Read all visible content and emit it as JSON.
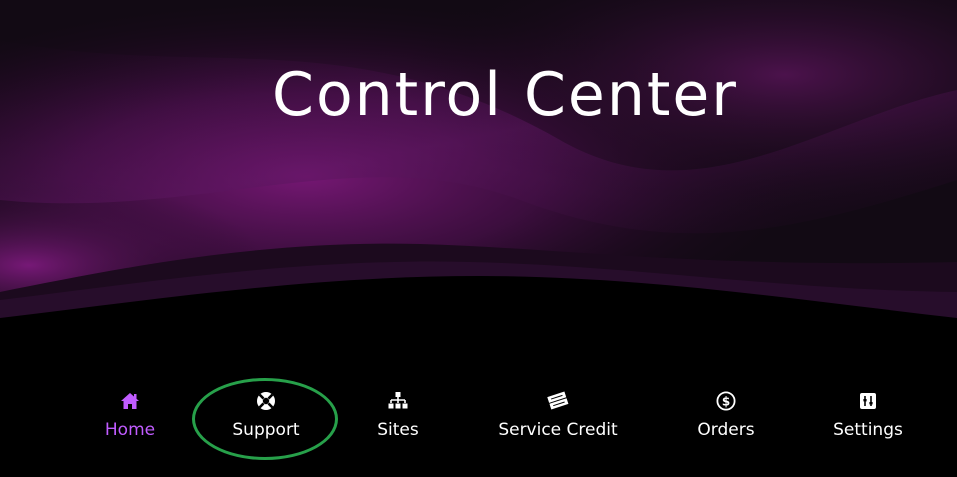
{
  "header": {
    "title": "Control Center"
  },
  "nav": {
    "items": [
      {
        "label": "Home",
        "icon": "home-icon",
        "active": true
      },
      {
        "label": "Support",
        "icon": "lifebuoy-icon",
        "active": false
      },
      {
        "label": "Sites",
        "icon": "sitemap-icon",
        "active": false
      },
      {
        "label": "Service Credit",
        "icon": "tickets-icon",
        "active": false
      },
      {
        "label": "Orders",
        "icon": "dollar-circle-icon",
        "active": false
      },
      {
        "label": "Settings",
        "icon": "sliders-icon",
        "active": false
      }
    ]
  },
  "colors": {
    "background": "#000000",
    "accent_purple": "#c05cff",
    "hero_purple": "#6a1670",
    "highlight_green": "#27a04a",
    "text": "#ffffff"
  }
}
